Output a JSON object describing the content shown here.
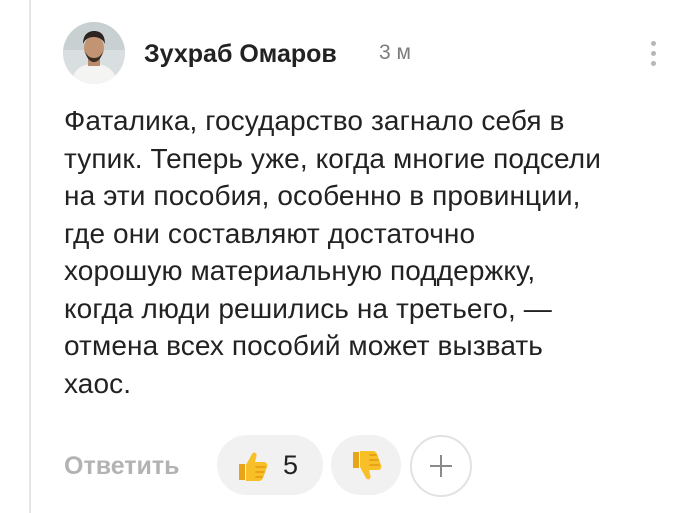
{
  "comment": {
    "author": "Зухраб Омаров",
    "time": "3 м",
    "text_lines": [
      "Фаталика, государство загнало себя в",
      "тупик. Теперь уже, когда многие подсели",
      "на эти пособия, особенно в провинции,",
      "где они составляют достаточно",
      "хорошую материальную поддержку,",
      "когда люди решились на третьего, —",
      "отмена всех пособий может вызвать",
      "хаос."
    ]
  },
  "actions": {
    "reply_label": "Ответить",
    "like_count": "5",
    "like_icon": "thumbs-up-emoji",
    "dislike_icon": "thumbs-down-emoji",
    "add_reaction_icon": "plus-icon",
    "menu_icon": "more-vertical-icon"
  },
  "colors": {
    "accent_reaction": "#f6b51e",
    "muted_text": "#b3b3b3",
    "pill_background": "#f1f1f1"
  }
}
